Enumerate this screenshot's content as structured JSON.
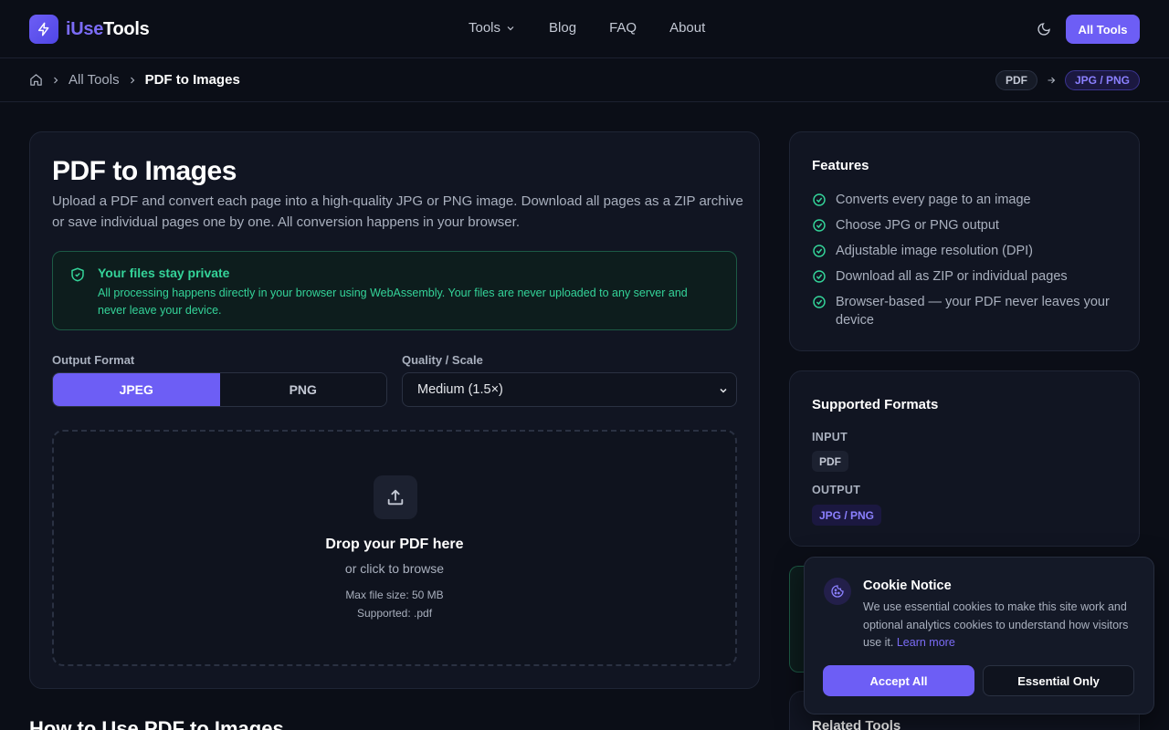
{
  "header": {
    "logo_part1": "iUse",
    "logo_part2": "Tools",
    "nav": [
      "Tools",
      "Blog",
      "FAQ",
      "About"
    ],
    "cta": "All Tools"
  },
  "breadcrumb": {
    "items": [
      "All Tools",
      "PDF to Images"
    ],
    "from_format": "PDF",
    "to_format": "JPG / PNG"
  },
  "tool": {
    "title": "PDF to Images",
    "description": "Upload a PDF and convert each page into a high-quality JPG or PNG image. Download all pages as a ZIP archive or save individual pages one by one. All conversion happens in your browser.",
    "privacy_title": "Your files stay private",
    "privacy_text": "All processing happens directly in your browser using WebAssembly. Your files are never uploaded to any server and never leave your device.",
    "output_format_label": "Output Format",
    "format_options": [
      "JPEG",
      "PNG"
    ],
    "selected_format": "JPEG",
    "quality_label": "Quality / Scale",
    "quality_value": "Medium (1.5×)",
    "drop_title": "Drop your PDF here",
    "drop_sub": "or click to browse",
    "max_size": "Max file size: 50 MB",
    "supported": "Supported: .pdf"
  },
  "howto_title": "How to Use PDF to Images",
  "features": {
    "title": "Features",
    "items": [
      "Converts every page to an image",
      "Choose JPG or PNG output",
      "Adjustable image resolution (DPI)",
      "Download all as ZIP or individual pages",
      "Browser-based — your PDF never leaves your device"
    ]
  },
  "formats": {
    "title": "Supported Formats",
    "input_label": "INPUT",
    "input_value": "PDF",
    "output_label": "OUTPUT",
    "output_value": "JPG / PNG"
  },
  "related_title": "Related Tools",
  "cookie": {
    "title": "Cookie Notice",
    "text": "We use essential cookies to make this site work and optional analytics cookies to understand how visitors use it.",
    "learn_more": "Learn more",
    "accept": "Accept All",
    "essential": "Essential Only"
  },
  "colors": {
    "accent": "#6d5ef5",
    "success": "#34d399",
    "background": "#0b0e17"
  }
}
